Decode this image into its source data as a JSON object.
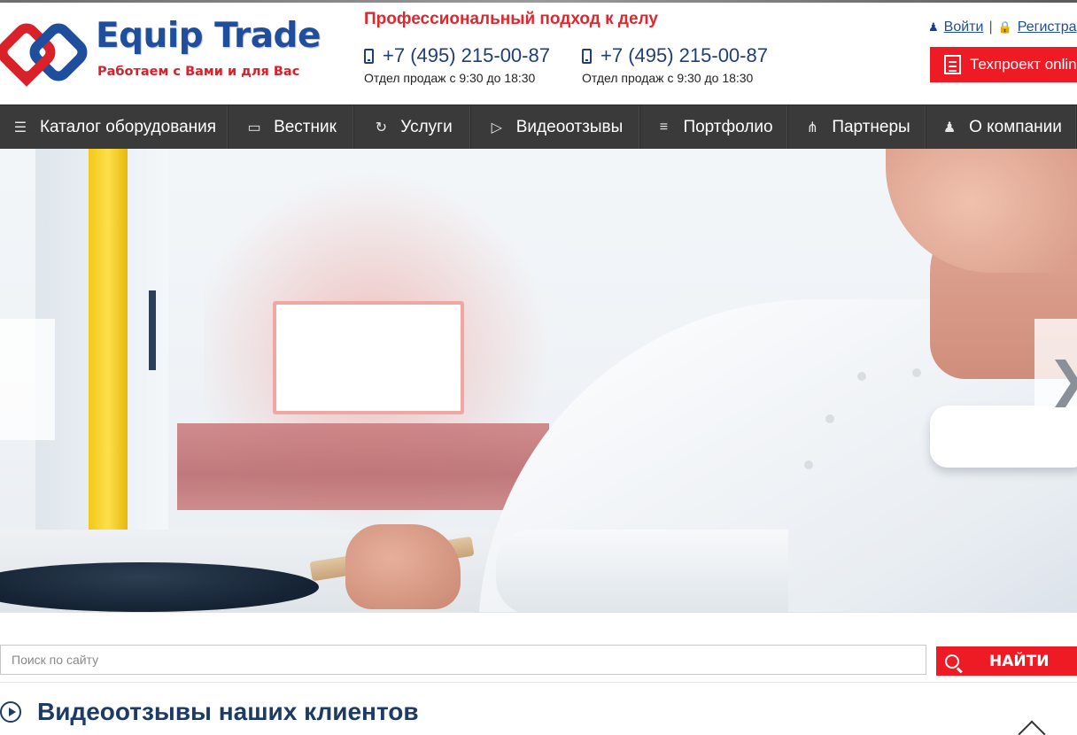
{
  "brand": {
    "name": "Equip Trade",
    "tagline": "Работаем с Вами и для Вас",
    "colors": {
      "blue": "#1f4e9c",
      "red": "#e3262d"
    }
  },
  "header": {
    "slogan": "Профессиональный подход к делу",
    "phones": [
      {
        "number": "+7 (495) 215-00-87",
        "hours": "Отдел продаж с 9:30 до 18:30",
        "icon": "mobile-phone-icon"
      },
      {
        "number": "+7 (495) 215-00-87",
        "hours": "Отдел продаж с 9:30 до 18:30",
        "icon": "mobile-phone-icon"
      }
    ],
    "auth": {
      "login": "Войти",
      "separator": "|",
      "register": "Регистра",
      "login_icon": "user-icon",
      "register_icon": "lock-icon"
    },
    "techproject_button": "Техпроект onlin"
  },
  "nav": {
    "items": [
      {
        "label": "Каталог оборудования",
        "icon": "menu-lines-icon"
      },
      {
        "label": "Вестник",
        "icon": "chat-bubble-icon"
      },
      {
        "label": "Услуги",
        "icon": "refresh-arrow-icon"
      },
      {
        "label": "Видеоотзывы",
        "icon": "play-circle-icon"
      },
      {
        "label": "Портфолио",
        "icon": "list-icon"
      },
      {
        "label": "Партнеры",
        "icon": "handshake-icon"
      },
      {
        "label": "О компании",
        "icon": "person-icon"
      }
    ]
  },
  "hero": {
    "next_arrow": "❯"
  },
  "search": {
    "placeholder": "Поиск по сайту",
    "button": "НАЙТИ",
    "icon": "search-icon"
  },
  "section": {
    "title": "Видеоотзывы наших клиентов",
    "icon": "play-circle-icon"
  },
  "accent_red": "#ee1b24",
  "nav_bg": "#3a3a3a"
}
